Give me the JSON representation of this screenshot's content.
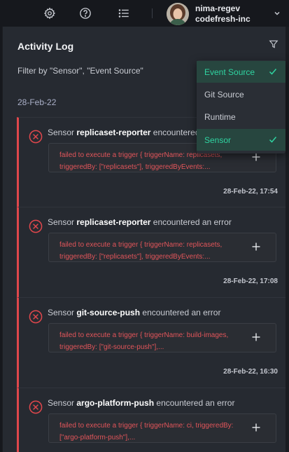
{
  "topbar": {
    "icons": [
      "settings-icon",
      "help-icon",
      "list-icon"
    ],
    "user": {
      "name": "nima-regev",
      "org": "codefresh-inc"
    }
  },
  "panel": {
    "title": "Activity Log",
    "filter_text": "Filter by \"Sensor\", \"Event Source\"",
    "date_group": "28-Feb-22"
  },
  "dropdown": {
    "items": [
      {
        "label": "Event Source",
        "selected": true
      },
      {
        "label": "Git Source",
        "selected": false
      },
      {
        "label": "Runtime",
        "selected": false
      },
      {
        "label": "Sensor",
        "selected": true
      }
    ]
  },
  "events": [
    {
      "type": "Sensor",
      "source": "replicaset-reporter",
      "message": "encountered an error",
      "details": "failed to execute a trigger { triggerName: replicasets, triggeredBy: [\"replicasets\"], triggeredByEvents:...",
      "time": "28-Feb-22, 17:54"
    },
    {
      "type": "Sensor",
      "source": "replicaset-reporter",
      "message": "encountered an error",
      "details": "failed to execute a trigger { triggerName: replicasets, triggeredBy: [\"replicasets\"], triggeredByEvents:...",
      "time": "28-Feb-22, 17:08"
    },
    {
      "type": "Sensor",
      "source": "git-source-push",
      "message": "encountered an error",
      "details": "failed to execute a trigger { triggerName: build-images, triggeredBy: [\"git-source-push\"],...",
      "time": "28-Feb-22, 16:30"
    },
    {
      "type": "Sensor",
      "source": "argo-platform-push",
      "message": "encountered an error",
      "details": "failed to execute a trigger { triggerName: ci, triggeredBy: [\"argo-platform-push\"],...",
      "time": ""
    }
  ],
  "colors": {
    "error": "#e0474c",
    "accent": "#2fd4a1",
    "panel": "#262a31",
    "background": "#16181d"
  }
}
